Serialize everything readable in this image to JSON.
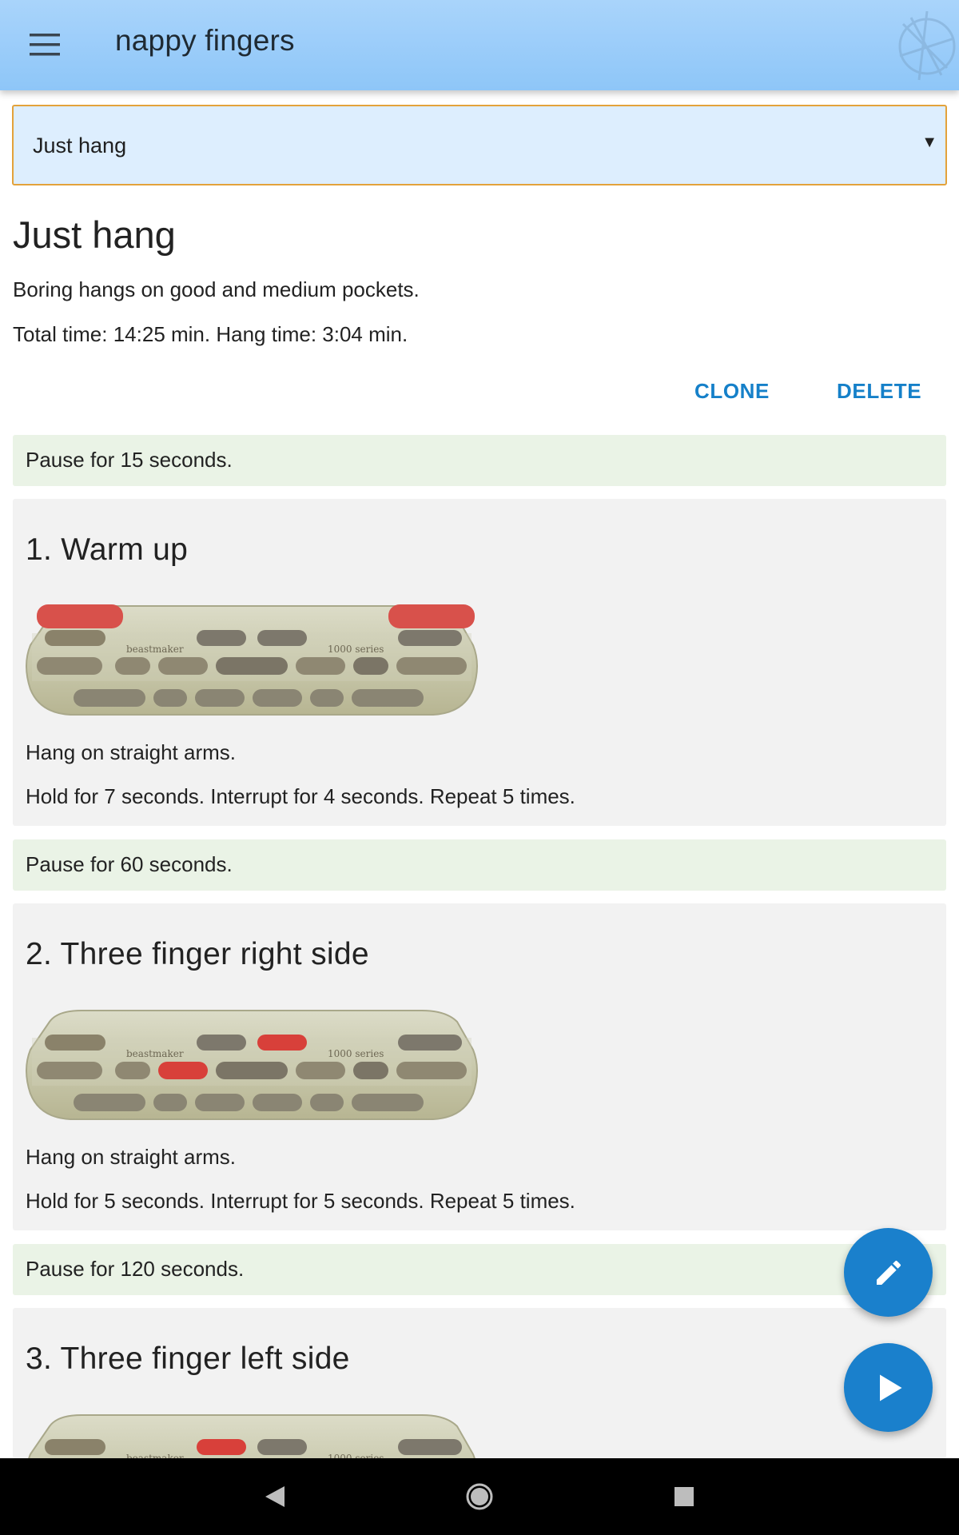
{
  "app": {
    "title": "nappy fingers"
  },
  "select": {
    "value": "Just hang"
  },
  "workout": {
    "title": "Just hang",
    "description": "Boring hangs on good and medium pockets.",
    "totals": "Total time: 14:25 min. Hang time: 3:04 min.",
    "clone_label": "CLONE",
    "delete_label": "DELETE"
  },
  "pauses": [
    "Pause for 15 seconds.",
    "Pause for 60 seconds.",
    "Pause for 120 seconds."
  ],
  "exercises": [
    {
      "title": "1. Warm up",
      "description": "Hang on straight arms.",
      "times": "Hold for 7 seconds. Interrupt for 4 seconds. Repeat 5 times.",
      "highlighted_holds": [
        "top-left-jug",
        "top-right-jug"
      ]
    },
    {
      "title": "2. Three finger right side",
      "description": "Hang on straight arms.",
      "times": "Hold for 5 seconds. Interrupt for 5 seconds. Repeat 5 times.",
      "highlighted_holds": [
        "top-pocket-right",
        "middle-pocket-left"
      ]
    },
    {
      "title": "3. Three finger left side",
      "description": "",
      "times": "",
      "highlighted_holds": [
        "top-pocket-left"
      ]
    }
  ],
  "hangboard": {
    "brand_text": "beastmaker",
    "series_text": "1000 series"
  },
  "icons": {
    "menu": "menu-icon",
    "logo": "logo-icon",
    "edit": "pencil-icon",
    "play": "play-icon",
    "back": "back-icon",
    "home": "home-icon",
    "recent": "recent-apps-icon"
  },
  "colors": {
    "appbar": "#8ec6f8",
    "accent": "#1580c9",
    "fab": "#1a80cc",
    "pause_bg": "#eaf3e6",
    "exercise_bg": "#f2f2f2",
    "select_border": "#e3a23b",
    "highlight_hold": "#d8403a"
  }
}
